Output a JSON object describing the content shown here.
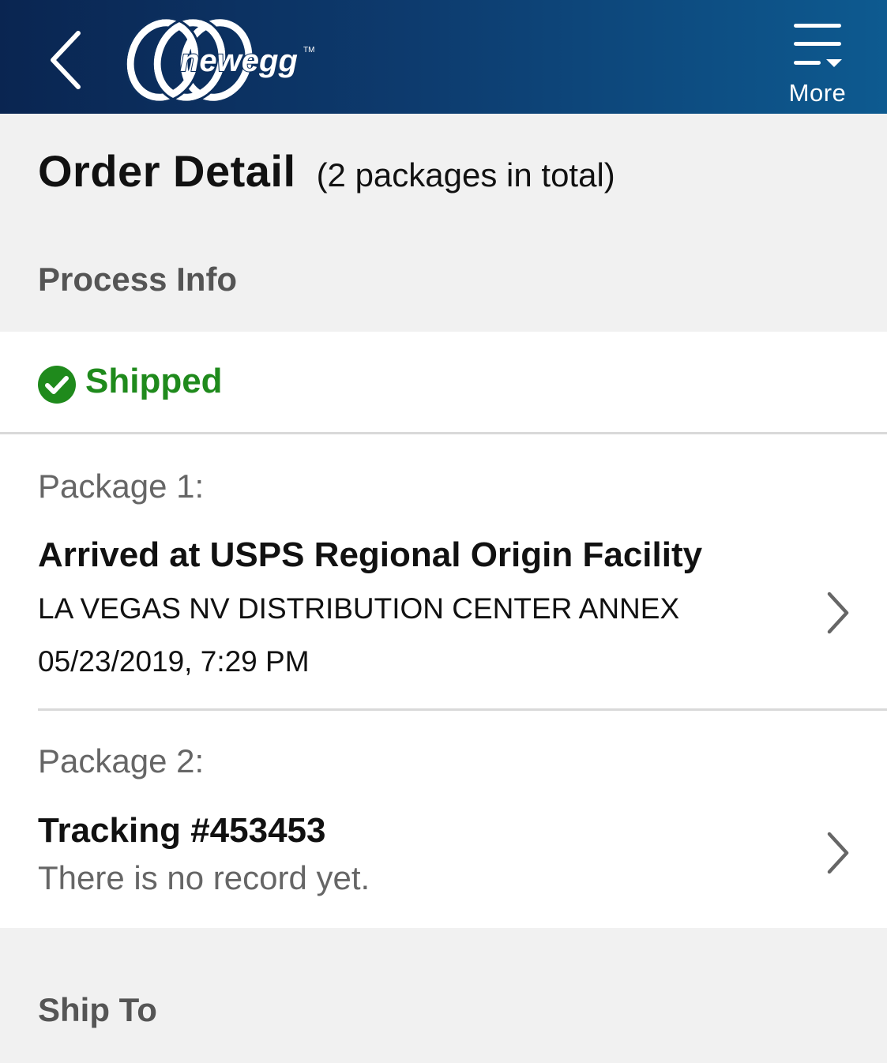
{
  "header": {
    "back_icon": "chevron-left-icon",
    "logo_text": "newegg",
    "more_label": "More",
    "more_icon": "menu-dropdown-icon",
    "gradient_colors": [
      "#0a2551",
      "#0d5a90"
    ]
  },
  "page": {
    "title": "Order Detail",
    "subtitle": "(2 packages in total)"
  },
  "process_info": {
    "header": "Process Info",
    "status": "Shipped",
    "status_icon": "check-circle-icon",
    "status_color": "#1f8a1c"
  },
  "packages": [
    {
      "label": "Package 1:",
      "status": "Arrived at USPS Regional Origin Facility",
      "location": "LA VEGAS NV DISTRIBUTION CENTER ANNEX",
      "datetime": "05/23/2019, 7:29 PM"
    },
    {
      "label": "Package 2:",
      "status": "Tracking #453453",
      "note": "There is no record yet."
    }
  ],
  "ship_to": {
    "header": "Ship To"
  }
}
